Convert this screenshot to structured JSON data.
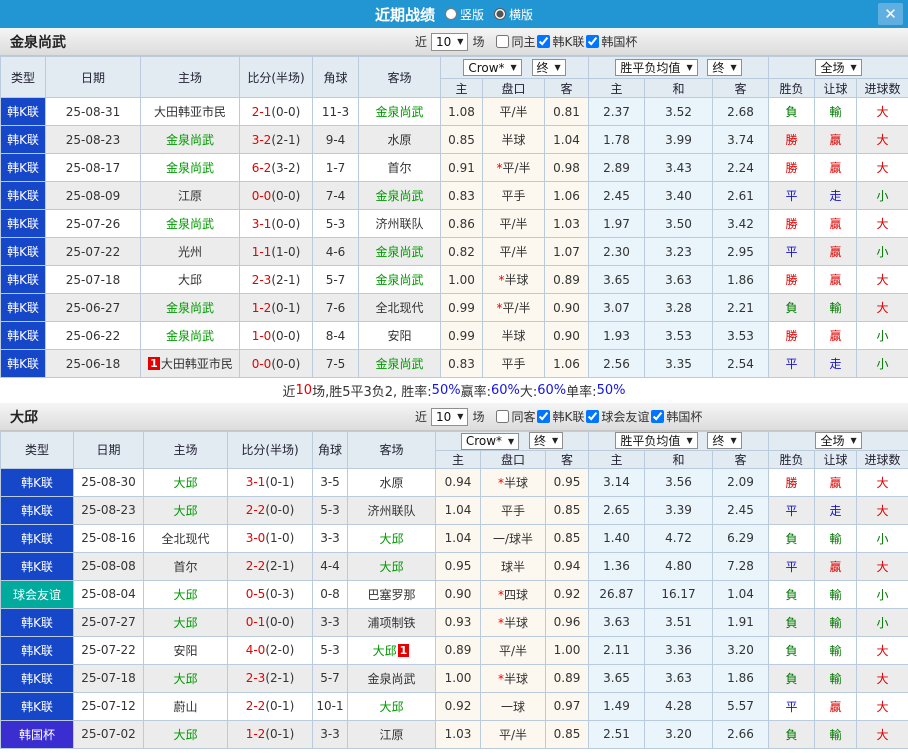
{
  "colors": {
    "bar": "#2196d3",
    "kleague": "#1747c9",
    "friendly": "#00ab9d",
    "cup": "#3a2ed0",
    "green": "#009900",
    "red": "#e60000",
    "crowbg": "#fdf8ef",
    "avgbg": "#e9f4fb"
  },
  "titlebar": {
    "title": "近期战绩",
    "vertical_label": "竖版",
    "horizontal_label": "横版",
    "close_glyph": "✕"
  },
  "table_header": {
    "type": "类型",
    "date": "日期",
    "home": "主场",
    "score": "比分(半场)",
    "corner": "角球",
    "away": "客场",
    "odds_home": "主",
    "odds_line": "盘口",
    "odds_away": "客",
    "avg_home": "主",
    "avg_draw": "和",
    "avg_away": "客",
    "result": "胜负",
    "handicap": "让球",
    "goals": "进球数",
    "crow_select": "Crow*",
    "final_select": "终",
    "avg_select": "胜平负均值",
    "full_select": "全场"
  },
  "sections": [
    {
      "team": "金泉尚武",
      "controls": {
        "near_label": "近",
        "count": "10",
        "unit_label": "场",
        "checks": [
          {
            "label": "同主",
            "checked": false
          },
          {
            "label": "韩K联",
            "checked": true
          },
          {
            "label": "韩国杯",
            "checked": true
          }
        ]
      },
      "rows": [
        {
          "league": "韩K联",
          "league_type": "kleague",
          "date": "25-08-31",
          "home": "大田韩亚市民",
          "home_green": false,
          "home_badge": "",
          "score": "2-1",
          "half": "(0-0)",
          "corner": "11-3",
          "away": "金泉尚武",
          "away_green": true,
          "away_badge": "",
          "crow": [
            "1.08",
            "平/半",
            "0.81"
          ],
          "line_star": false,
          "avg": [
            "2.37",
            "3.52",
            "2.68"
          ],
          "result": "負",
          "handicap": "輸",
          "goals": "大"
        },
        {
          "league": "韩K联",
          "league_type": "kleague",
          "date": "25-08-23",
          "home": "金泉尚武",
          "home_green": true,
          "home_badge": "",
          "score": "3-2",
          "half": "(2-1)",
          "corner": "9-4",
          "away": "水原",
          "away_green": false,
          "away_badge": "",
          "crow": [
            "0.85",
            "半球",
            "1.04"
          ],
          "line_star": false,
          "avg": [
            "1.78",
            "3.99",
            "3.74"
          ],
          "result": "勝",
          "handicap": "贏",
          "goals": "大"
        },
        {
          "league": "韩K联",
          "league_type": "kleague",
          "date": "25-08-17",
          "home": "金泉尚武",
          "home_green": true,
          "home_badge": "",
          "score": "6-2",
          "half": "(3-2)",
          "corner": "1-7",
          "away": "首尔",
          "away_green": false,
          "away_badge": "",
          "crow": [
            "0.91",
            "平/半",
            "0.98"
          ],
          "line_star": true,
          "avg": [
            "2.89",
            "3.43",
            "2.24"
          ],
          "result": "勝",
          "handicap": "贏",
          "goals": "大"
        },
        {
          "league": "韩K联",
          "league_type": "kleague",
          "date": "25-08-09",
          "home": "江原",
          "home_green": false,
          "home_badge": "",
          "score": "0-0",
          "half": "(0-0)",
          "corner": "7-4",
          "away": "金泉尚武",
          "away_green": true,
          "away_badge": "",
          "crow": [
            "0.83",
            "平手",
            "1.06"
          ],
          "line_star": false,
          "avg": [
            "2.45",
            "3.40",
            "2.61"
          ],
          "result": "平",
          "handicap": "走",
          "goals": "小"
        },
        {
          "league": "韩K联",
          "league_type": "kleague",
          "date": "25-07-26",
          "home": "金泉尚武",
          "home_green": true,
          "home_badge": "",
          "score": "3-1",
          "half": "(0-0)",
          "corner": "5-3",
          "away": "济州联队",
          "away_green": false,
          "away_badge": "",
          "crow": [
            "0.86",
            "平/半",
            "1.03"
          ],
          "line_star": false,
          "avg": [
            "1.97",
            "3.50",
            "3.42"
          ],
          "result": "勝",
          "handicap": "贏",
          "goals": "大"
        },
        {
          "league": "韩K联",
          "league_type": "kleague",
          "date": "25-07-22",
          "home": "光州",
          "home_green": false,
          "home_badge": "",
          "score": "1-1",
          "half": "(1-0)",
          "corner": "4-6",
          "away": "金泉尚武",
          "away_green": true,
          "away_badge": "",
          "crow": [
            "0.82",
            "平/半",
            "1.07"
          ],
          "line_star": false,
          "avg": [
            "2.30",
            "3.23",
            "2.95"
          ],
          "result": "平",
          "handicap": "贏",
          "goals": "小"
        },
        {
          "league": "韩K联",
          "league_type": "kleague",
          "date": "25-07-18",
          "home": "大邱",
          "home_green": false,
          "home_badge": "",
          "score": "2-3",
          "half": "(2-1)",
          "corner": "5-7",
          "away": "金泉尚武",
          "away_green": true,
          "away_badge": "",
          "crow": [
            "1.00",
            "半球",
            "0.89"
          ],
          "line_star": true,
          "avg": [
            "3.65",
            "3.63",
            "1.86"
          ],
          "result": "勝",
          "handicap": "贏",
          "goals": "大"
        },
        {
          "league": "韩K联",
          "league_type": "kleague",
          "date": "25-06-27",
          "home": "金泉尚武",
          "home_green": true,
          "home_badge": "",
          "score": "1-2",
          "half": "(0-1)",
          "corner": "7-6",
          "away": "全北现代",
          "away_green": false,
          "away_badge": "",
          "crow": [
            "0.99",
            "平/半",
            "0.90"
          ],
          "line_star": true,
          "avg": [
            "3.07",
            "3.28",
            "2.21"
          ],
          "result": "負",
          "handicap": "輸",
          "goals": "大"
        },
        {
          "league": "韩K联",
          "league_type": "kleague",
          "date": "25-06-22",
          "home": "金泉尚武",
          "home_green": true,
          "home_badge": "",
          "score": "1-0",
          "half": "(0-0)",
          "corner": "8-4",
          "away": "安阳",
          "away_green": false,
          "away_badge": "",
          "crow": [
            "0.99",
            "半球",
            "0.90"
          ],
          "line_star": false,
          "avg": [
            "1.93",
            "3.53",
            "3.53"
          ],
          "result": "勝",
          "handicap": "贏",
          "goals": "小"
        },
        {
          "league": "韩K联",
          "league_type": "kleague",
          "date": "25-06-18",
          "home": "大田韩亚市民",
          "home_green": false,
          "home_badge": "1",
          "score": "0-0",
          "half": "(0-0)",
          "corner": "7-5",
          "away": "金泉尚武",
          "away_green": true,
          "away_badge": "",
          "crow": [
            "0.83",
            "平手",
            "1.06"
          ],
          "line_star": false,
          "avg": [
            "2.56",
            "3.35",
            "2.54"
          ],
          "result": "平",
          "handicap": "走",
          "goals": "小"
        }
      ],
      "summary": [
        {
          "text": "近",
          "color": "dark"
        },
        {
          "text": "10",
          "color": "red"
        },
        {
          "text": "场,胜5平3负2, 胜率:",
          "color": "dark"
        },
        {
          "text": "50%",
          "color": "blue"
        },
        {
          "text": " 赢率:",
          "color": "dark"
        },
        {
          "text": "60%",
          "color": "blue"
        },
        {
          "text": " 大:",
          "color": "dark"
        },
        {
          "text": "60%",
          "color": "blue"
        },
        {
          "text": " 单率:",
          "color": "dark"
        },
        {
          "text": "50%",
          "color": "blue"
        }
      ]
    },
    {
      "team": "大邱",
      "controls": {
        "near_label": "近",
        "count": "10",
        "unit_label": "场",
        "checks": [
          {
            "label": "同客",
            "checked": false
          },
          {
            "label": "韩K联",
            "checked": true
          },
          {
            "label": "球会友谊",
            "checked": true
          },
          {
            "label": "韩国杯",
            "checked": true
          }
        ]
      },
      "rows": [
        {
          "league": "韩K联",
          "league_type": "kleague",
          "date": "25-08-30",
          "home": "大邱",
          "home_green": true,
          "home_badge": "",
          "score": "3-1",
          "half": "(0-1)",
          "corner": "3-5",
          "away": "水原",
          "away_green": false,
          "away_badge": "",
          "crow": [
            "0.94",
            "半球",
            "0.95"
          ],
          "line_star": true,
          "avg": [
            "3.14",
            "3.56",
            "2.09"
          ],
          "result": "勝",
          "handicap": "贏",
          "goals": "大"
        },
        {
          "league": "韩K联",
          "league_type": "kleague",
          "date": "25-08-23",
          "home": "大邱",
          "home_green": true,
          "home_badge": "",
          "score": "2-2",
          "half": "(0-0)",
          "corner": "5-3",
          "away": "济州联队",
          "away_green": false,
          "away_badge": "",
          "crow": [
            "1.04",
            "平手",
            "0.85"
          ],
          "line_star": false,
          "avg": [
            "2.65",
            "3.39",
            "2.45"
          ],
          "result": "平",
          "handicap": "走",
          "goals": "大"
        },
        {
          "league": "韩K联",
          "league_type": "kleague",
          "date": "25-08-16",
          "home": "全北现代",
          "home_green": false,
          "home_badge": "",
          "score": "3-0",
          "half": "(1-0)",
          "corner": "3-3",
          "away": "大邱",
          "away_green": true,
          "away_badge": "",
          "crow": [
            "1.04",
            "一/球半",
            "0.85"
          ],
          "line_star": false,
          "avg": [
            "1.40",
            "4.72",
            "6.29"
          ],
          "result": "負",
          "handicap": "輸",
          "goals": "小"
        },
        {
          "league": "韩K联",
          "league_type": "kleague",
          "date": "25-08-08",
          "home": "首尔",
          "home_green": false,
          "home_badge": "",
          "score": "2-2",
          "half": "(2-1)",
          "corner": "4-4",
          "away": "大邱",
          "away_green": true,
          "away_badge": "",
          "crow": [
            "0.95",
            "球半",
            "0.94"
          ],
          "line_star": false,
          "avg": [
            "1.36",
            "4.80",
            "7.28"
          ],
          "result": "平",
          "handicap": "贏",
          "goals": "大"
        },
        {
          "league": "球会友谊",
          "league_type": "friendly",
          "date": "25-08-04",
          "home": "大邱",
          "home_green": true,
          "home_badge": "",
          "score": "0-5",
          "half": "(0-3)",
          "corner": "0-8",
          "away": "巴塞罗那",
          "away_green": false,
          "away_badge": "",
          "crow": [
            "0.90",
            "四球",
            "0.92"
          ],
          "line_star": true,
          "avg": [
            "26.87",
            "16.17",
            "1.04"
          ],
          "result": "負",
          "handicap": "輸",
          "goals": "小"
        },
        {
          "league": "韩K联",
          "league_type": "kleague",
          "date": "25-07-27",
          "home": "大邱",
          "home_green": true,
          "home_badge": "",
          "score": "0-1",
          "half": "(0-0)",
          "corner": "3-3",
          "away": "浦项制铁",
          "away_green": false,
          "away_badge": "",
          "crow": [
            "0.93",
            "半球",
            "0.96"
          ],
          "line_star": true,
          "avg": [
            "3.63",
            "3.51",
            "1.91"
          ],
          "result": "負",
          "handicap": "輸",
          "goals": "小"
        },
        {
          "league": "韩K联",
          "league_type": "kleague",
          "date": "25-07-22",
          "home": "安阳",
          "home_green": false,
          "home_badge": "",
          "score": "4-0",
          "half": "(2-0)",
          "corner": "5-3",
          "away": "大邱",
          "away_green": true,
          "away_badge": "1",
          "crow": [
            "0.89",
            "平/半",
            "1.00"
          ],
          "line_star": false,
          "avg": [
            "2.11",
            "3.36",
            "3.20"
          ],
          "result": "負",
          "handicap": "輸",
          "goals": "大"
        },
        {
          "league": "韩K联",
          "league_type": "kleague",
          "date": "25-07-18",
          "home": "大邱",
          "home_green": true,
          "home_badge": "",
          "score": "2-3",
          "half": "(2-1)",
          "corner": "5-7",
          "away": "金泉尚武",
          "away_green": false,
          "away_badge": "",
          "crow": [
            "1.00",
            "半球",
            "0.89"
          ],
          "line_star": true,
          "avg": [
            "3.65",
            "3.63",
            "1.86"
          ],
          "result": "負",
          "handicap": "輸",
          "goals": "大"
        },
        {
          "league": "韩K联",
          "league_type": "kleague",
          "date": "25-07-12",
          "home": "蔚山",
          "home_green": false,
          "home_badge": "",
          "score": "2-2",
          "half": "(0-1)",
          "corner": "10-1",
          "away": "大邱",
          "away_green": true,
          "away_badge": "",
          "crow": [
            "0.92",
            "一球",
            "0.97"
          ],
          "line_star": false,
          "avg": [
            "1.49",
            "4.28",
            "5.57"
          ],
          "result": "平",
          "handicap": "贏",
          "goals": "大"
        },
        {
          "league": "韩国杯",
          "league_type": "cup",
          "date": "25-07-02",
          "home": "大邱",
          "home_green": true,
          "home_badge": "",
          "score": "1-2",
          "half": "(0-1)",
          "corner": "3-3",
          "away": "江原",
          "away_green": false,
          "away_badge": "",
          "crow": [
            "1.03",
            "平/半",
            "0.85"
          ],
          "line_star": false,
          "avg": [
            "2.51",
            "3.20",
            "2.66"
          ],
          "result": "負",
          "handicap": "輸",
          "goals": "大"
        }
      ],
      "summary": []
    }
  ]
}
